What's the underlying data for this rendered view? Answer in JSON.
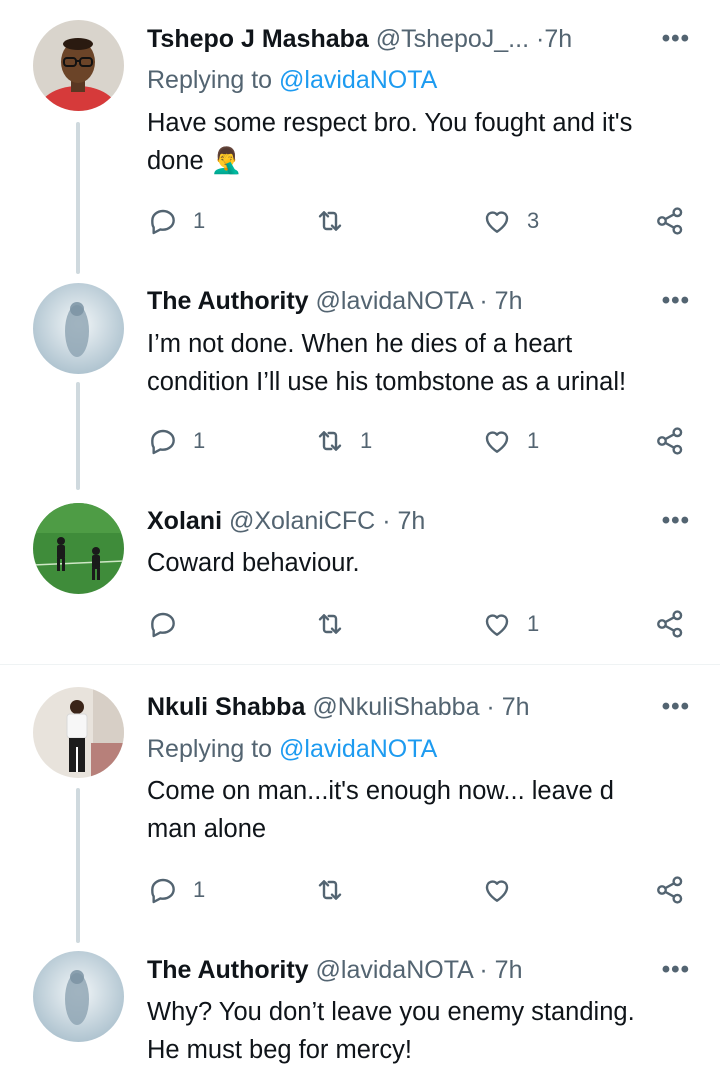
{
  "tweets": [
    {
      "name": "Tshepo J Mashaba",
      "handle": "@TshepoJ_...",
      "sep": "·",
      "time": "7h",
      "replying_label": "Replying to",
      "replying_to": "@lavidaNOTA",
      "text_lines": [
        "Have some respect bro. You fought and it's",
        "done 🤦‍♂️"
      ],
      "reply_count": "1",
      "retweet_count": "",
      "like_count": "3",
      "more": "•••"
    },
    {
      "name": "The Authority",
      "handle": "@lavidaNOTA",
      "sep": "·",
      "time": "7h",
      "text_lines": [
        "I’m not done. When he dies of a heart",
        "condition I’ll use his tombstone as a urinal!"
      ],
      "reply_count": "1",
      "retweet_count": "1",
      "like_count": "1",
      "more": "•••"
    },
    {
      "name": "Xolani",
      "handle": "@XolaniCFC",
      "sep": "·",
      "time": "7h",
      "text_lines": [
        "Coward behaviour."
      ],
      "reply_count": "",
      "retweet_count": "",
      "like_count": "1",
      "more": "•••"
    },
    {
      "name": "Nkuli Shabba",
      "handle": "@NkuliShabba",
      "sep": "·",
      "time": "7h",
      "replying_label": "Replying to",
      "replying_to": "@lavidaNOTA",
      "text_lines": [
        "Come on man...it's enough now... leave d",
        "man alone"
      ],
      "reply_count": "1",
      "retweet_count": "",
      "like_count": "",
      "more": "•••"
    },
    {
      "name": "The Authority",
      "handle": "@lavidaNOTA",
      "sep": "·",
      "time": "7h",
      "text_lines": [
        "Why? You don’t leave you enemy standing.",
        "He must beg for mercy!"
      ],
      "more": "•••"
    }
  ],
  "icons": {
    "reply": "reply-icon",
    "retweet": "retweet-icon",
    "like": "heart-icon",
    "share": "share-icon",
    "more": "more-options-icon"
  },
  "colors": {
    "text": "#0f1419",
    "secondary": "#536471",
    "link": "#1d9bf0",
    "thread_line": "#cfd9de",
    "divider": "#eff3f4"
  }
}
